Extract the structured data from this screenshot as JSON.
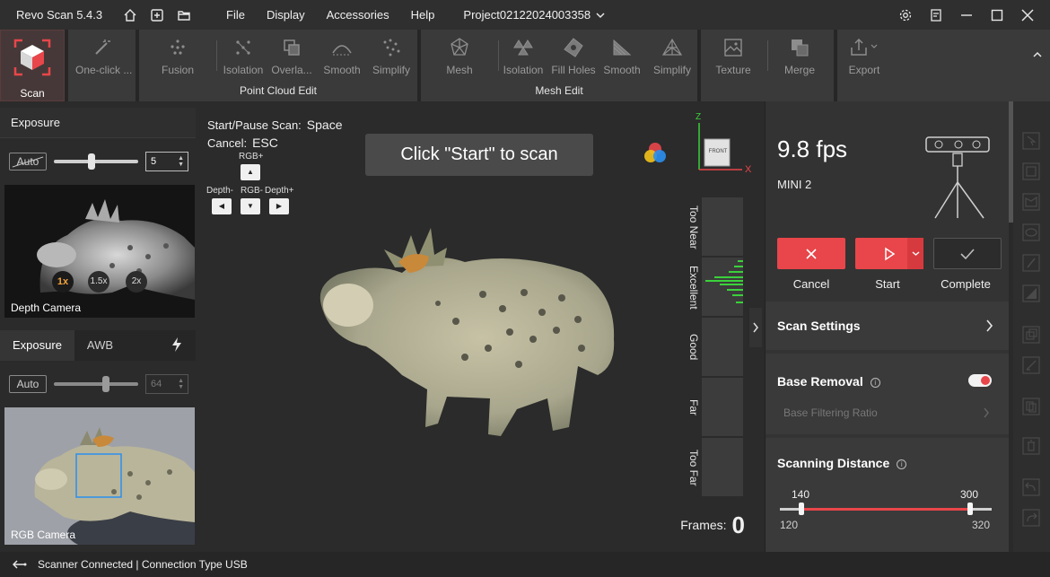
{
  "titlebar": {
    "app_title": "Revo Scan 5.4.3",
    "menu": [
      "File",
      "Display",
      "Accessories",
      "Help"
    ],
    "project": "Project02122024003358"
  },
  "ribbon": {
    "scan_label": "Scan",
    "one_click_label": "One-click ...",
    "point_cloud_group": "Point Cloud Edit",
    "point_cloud_tools": [
      "Fusion",
      "Isolation",
      "Overla...",
      "Smooth",
      "Simplify"
    ],
    "mesh_group": "Mesh Edit",
    "mesh_tools": [
      "Mesh",
      "Isolation",
      "Fill Holes",
      "Smooth",
      "Simplify"
    ],
    "texture_label": "Texture",
    "merge_label": "Merge",
    "export_label": "Export"
  },
  "left": {
    "depth_header": "Exposure",
    "depth_auto": "Auto",
    "depth_value": "5",
    "zoom_levels": [
      "1x",
      "1.5x",
      "2x"
    ],
    "depth_label": "Depth Camera",
    "tabs": [
      "Exposure",
      "AWB"
    ],
    "rgb_auto": "Auto",
    "rgb_value": "64",
    "rgb_label": "RGB Camera"
  },
  "viewport": {
    "start_hint": "Start/Pause Scan:",
    "start_key": "Space",
    "cancel_hint": "Cancel:",
    "cancel_key": "ESC",
    "rgb_plus": "RGB+",
    "rgb_minus": "RGB-",
    "depth_minus": "Depth-",
    "depth_plus": "Depth+",
    "banner": "Click \"Start\" to scan",
    "axis_z": "Z",
    "axis_x": "X",
    "front": "FRONT",
    "distance_labels": [
      "Too Near",
      "Excellent",
      "Good",
      "Far",
      "Too Far"
    ],
    "frames_label": "Frames:",
    "frames_value": "0"
  },
  "right": {
    "fps": "9.8 fps",
    "device": "MINI 2",
    "cancel": "Cancel",
    "start": "Start",
    "complete": "Complete",
    "scan_settings": "Scan Settings",
    "base_removal": "Base Removal",
    "base_filtering": "Base Filtering Ratio",
    "base_removal_on": true,
    "scanning_distance": "Scanning Distance",
    "range_low": "140",
    "range_high": "300",
    "range_min": "120",
    "range_max": "320",
    "range_min_value": 120,
    "range_max_value": 320,
    "range_low_value": 140,
    "range_high_value": 300
  },
  "status": {
    "text": "Scanner Connected | Connection Type USB"
  },
  "colors": {
    "accent_red": "#e8464a",
    "bg": "#2b2b2b",
    "panel": "#333333"
  }
}
